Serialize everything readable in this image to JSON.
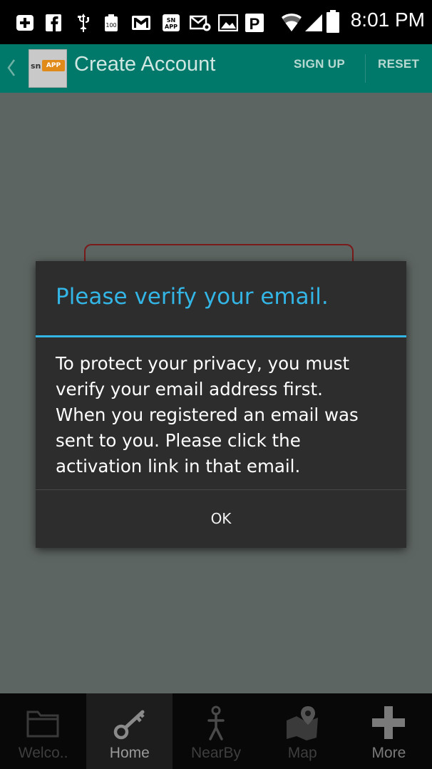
{
  "status_bar": {
    "time": "8:01 PM",
    "icons": [
      "plus-notification-icon",
      "facebook-icon",
      "usb-icon",
      "battery-100-notification-icon",
      "gmail-icon",
      "snapp-icon",
      "email-icon",
      "gallery-icon",
      "parking-icon",
      "wifi-icon",
      "signal-icon",
      "battery-icon"
    ],
    "battery_label": "100",
    "snapp_label": "SN APP",
    "parking_label": "P"
  },
  "app_bar": {
    "title": "Create Account",
    "logo_text": "sn",
    "logo_badge": "APP",
    "actions": {
      "sign_up": "SIGN UP",
      "reset": "RESET"
    },
    "accent_color": "#00796b"
  },
  "dialog": {
    "title": "Please verify your email.",
    "message_lines": [
      "To protect your privacy, you must",
      "verify your email address first.",
      "When you registered an email was",
      "sent to you.  Please click the",
      "activation link in that email."
    ],
    "ok_label": "OK",
    "accent_color": "#33b5e5"
  },
  "tab_bar": {
    "active": "Home",
    "tabs": [
      {
        "label": "Welco..",
        "icon": "folder-icon"
      },
      {
        "label": "Home",
        "icon": "key-icon"
      },
      {
        "label": "NearBy",
        "icon": "walking-person-icon"
      },
      {
        "label": "Map",
        "icon": "map-pin-icon"
      },
      {
        "label": "More",
        "icon": "plus-icon"
      }
    ]
  }
}
